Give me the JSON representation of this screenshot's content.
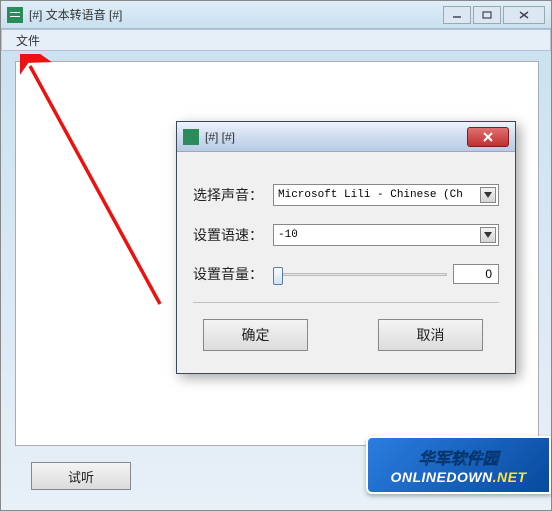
{
  "main_window": {
    "title": "[#] 文本转语音 [#]",
    "menu": {
      "file": "文件"
    },
    "listen_button": "试听"
  },
  "dialog": {
    "title": "[#] [#]",
    "rows": {
      "voice_label": "选择声音：",
      "voice_value": "Microsoft Lili - Chinese (Ch",
      "rate_label": "设置语速：",
      "rate_value": "-10",
      "volume_label": "设置音量：",
      "volume_value": "0"
    },
    "buttons": {
      "ok": "确定",
      "cancel": "取消"
    }
  },
  "watermark": {
    "cn": "华军软件园",
    "en_main": "ONLINEDOWN",
    "en_suffix": ".NET"
  }
}
